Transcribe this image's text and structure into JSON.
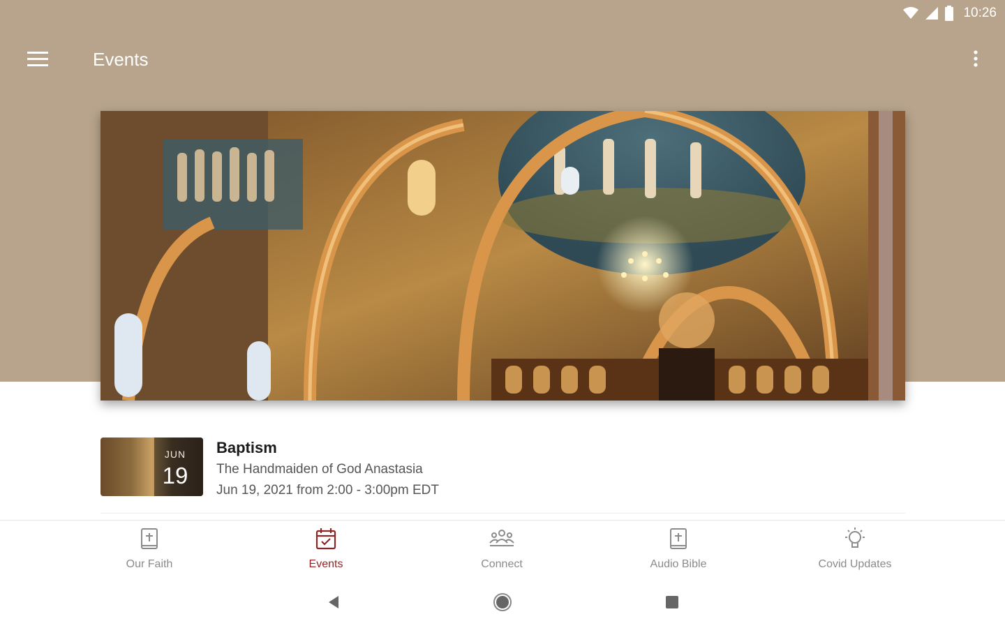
{
  "status_bar": {
    "time": "10:26"
  },
  "app_bar": {
    "title": "Events"
  },
  "hero": {
    "image_icon": "church-interior-image"
  },
  "event": {
    "month": "JUN",
    "day": "19",
    "title": "Baptism",
    "subtitle": "The Handmaiden of God Anastasia",
    "time": "Jun 19, 2021 from 2:00 - 3:00pm EDT"
  },
  "bottom_nav": {
    "items": [
      {
        "label": "Our Faith",
        "icon": "book-cross-icon",
        "active": false
      },
      {
        "label": "Events",
        "icon": "calendar-check-icon",
        "active": true
      },
      {
        "label": "Connect",
        "icon": "group-icon",
        "active": false
      },
      {
        "label": "Audio Bible",
        "icon": "book-cross-icon",
        "active": false
      },
      {
        "label": "Covid Updates",
        "icon": "lightbulb-icon",
        "active": false
      }
    ]
  },
  "colors": {
    "header_bg": "#b8a48c",
    "accent": "#8d2525",
    "inactive": "#8a8a8a"
  }
}
